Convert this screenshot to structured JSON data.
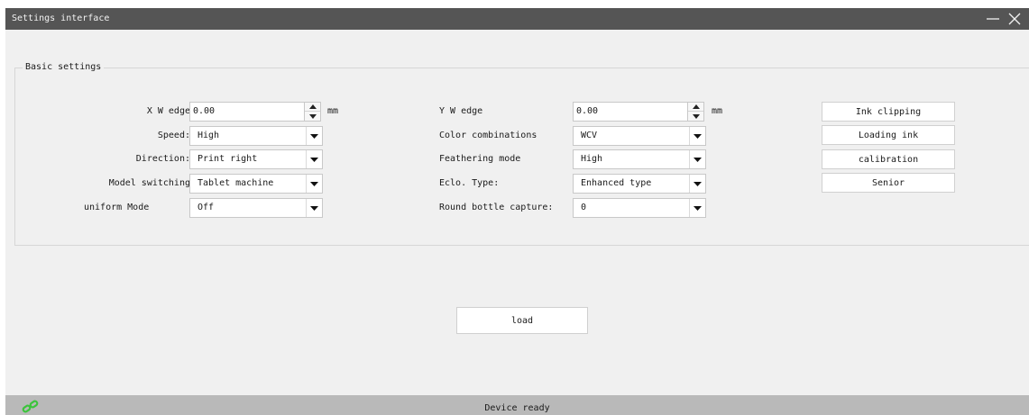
{
  "window": {
    "title": "Settings interface"
  },
  "group": {
    "title": "Basic settings"
  },
  "fields": {
    "x_edge": {
      "label": "X W edge",
      "value": "0.00",
      "unit": "mm"
    },
    "y_edge": {
      "label": "Y W edge",
      "value": "0.00",
      "unit": "mm"
    },
    "speed": {
      "label": "Speed:",
      "value": "High"
    },
    "direction": {
      "label": "Direction:",
      "value": "Print right"
    },
    "model_switching": {
      "label": "Model switching",
      "value": "Tablet machine"
    },
    "uniform_mode": {
      "label": "uniform Mode",
      "value": "Off"
    },
    "color_combinations": {
      "label": "Color combinations",
      "value": "WCV"
    },
    "feathering_mode": {
      "label": "Feathering mode",
      "value": "High"
    },
    "eclo_type": {
      "label": "Eclo. Type:",
      "value": "Enhanced type"
    },
    "round_bottle_capture": {
      "label": "Round bottle capture:",
      "value": "0"
    }
  },
  "buttons": {
    "ink_clipping": "Ink clipping",
    "loading_ink": "Loading ink",
    "calibration": "calibration",
    "senior": "Senior",
    "load": "load"
  },
  "status": {
    "text": "Device ready",
    "icon": "link-icon",
    "icon_color": "#3cc43c"
  },
  "colors": {
    "titlebar": "#555555",
    "window_bg": "#f0f0f0",
    "statusbar": "#b9b9b9"
  }
}
